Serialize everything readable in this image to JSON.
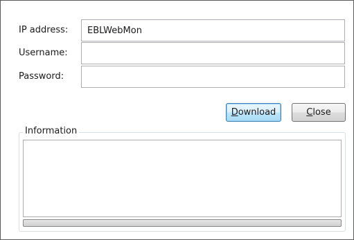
{
  "form": {
    "ip_label": "IP address:",
    "ip_value": "EBLWebMon",
    "username_label": "Username:",
    "username_value": "",
    "password_label": "Password:",
    "password_value": ""
  },
  "buttons": {
    "download": {
      "mnemonic": "D",
      "rest": "ownload"
    },
    "close": {
      "mnemonic": "C",
      "rest": "lose"
    }
  },
  "information": {
    "title": "Information",
    "text": "",
    "progress": 0
  }
}
